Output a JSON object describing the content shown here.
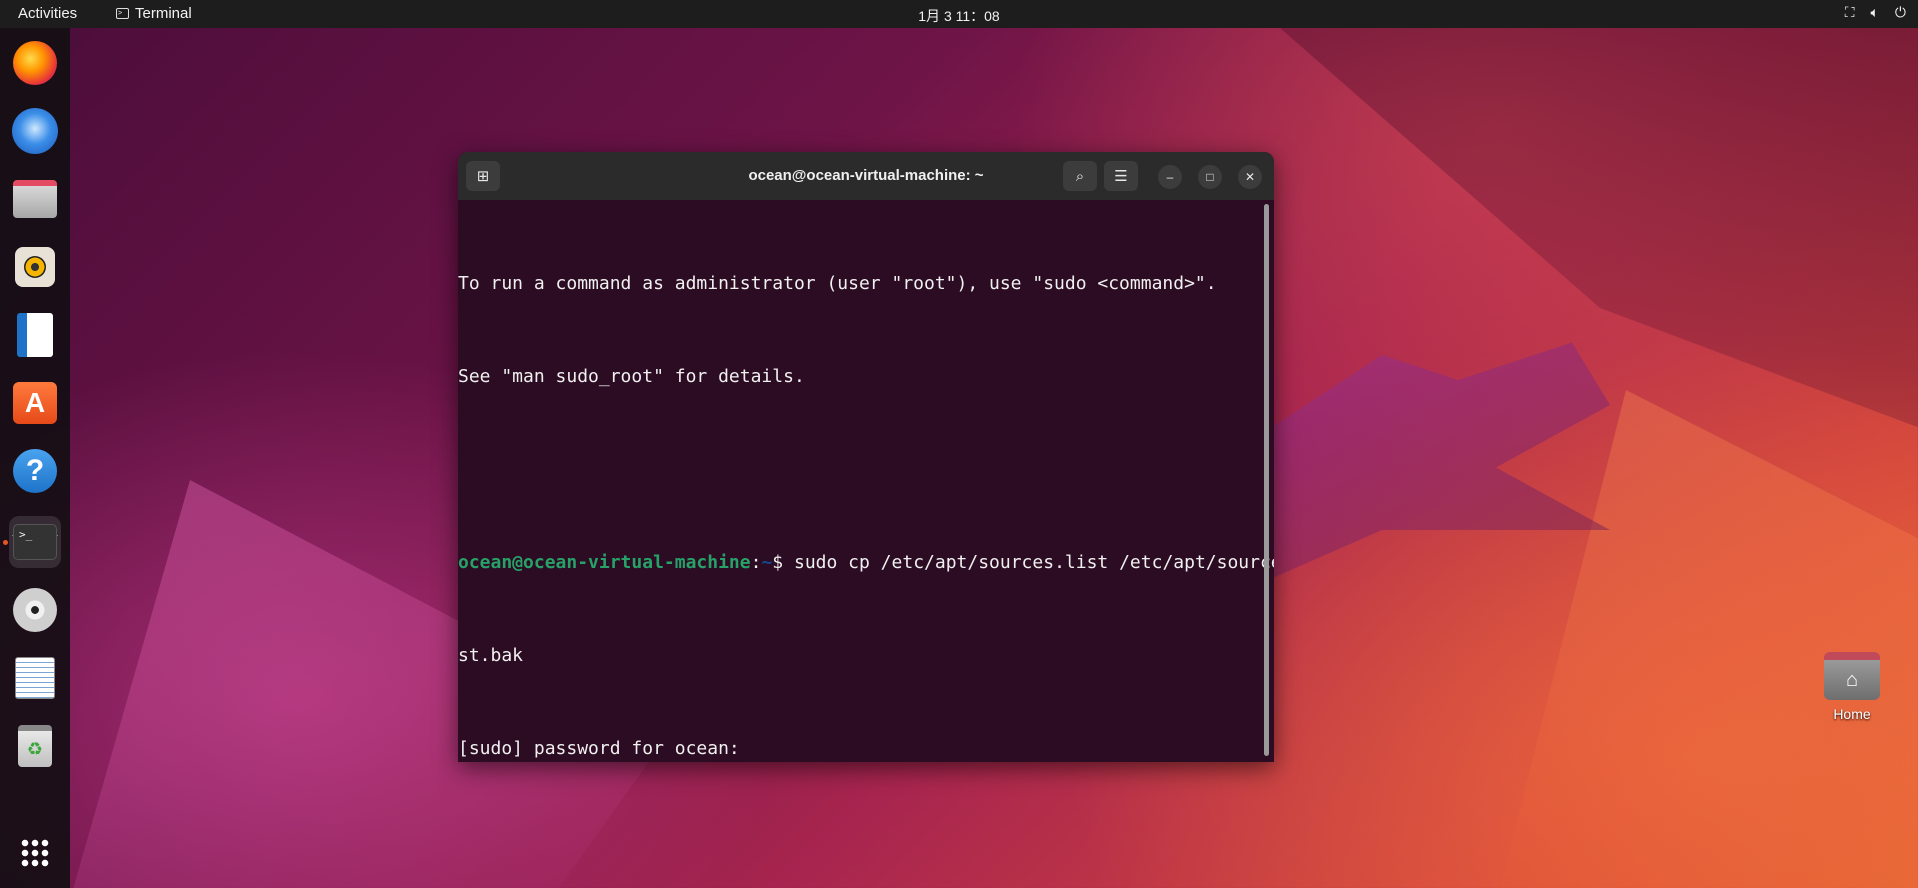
{
  "topbar": {
    "activities": "Activities",
    "app_name": "Terminal",
    "clock": "1月 3  11：08",
    "tray_icons": [
      "network-icon",
      "volume-icon",
      "power-icon"
    ]
  },
  "dock": {
    "apps": [
      {
        "name": "firefox",
        "icon": "firefox-icon"
      },
      {
        "name": "thunderbird",
        "icon": "thunderbird-icon"
      },
      {
        "name": "files",
        "icon": "files-icon"
      },
      {
        "name": "rhythmbox",
        "icon": "rhythmbox-icon"
      },
      {
        "name": "libreoffice-writer",
        "icon": "writer-icon"
      },
      {
        "name": "ubuntu-software",
        "icon": "software-store-icon"
      },
      {
        "name": "help",
        "icon": "help-icon"
      },
      {
        "name": "terminal",
        "icon": "terminal-icon",
        "running": true
      },
      {
        "name": "disc",
        "icon": "disc-icon"
      },
      {
        "name": "text-editor",
        "icon": "text-editor-icon"
      },
      {
        "name": "trash",
        "icon": "trash-icon"
      }
    ],
    "store_glyph": "A",
    "help_glyph": "?",
    "terminal_glyph": ">_"
  },
  "desktop": {
    "home_label": "Home"
  },
  "window": {
    "title": "ocean@ocean-virtual-machine: ~",
    "accent": "#26a269",
    "background": "#2c0c22"
  },
  "terminal": {
    "line1": "To run a command as administrator (user \"root\"), use \"sudo <command>\".",
    "line2": "See \"man sudo_root\" for details.",
    "prompt_user": "ocean@ocean-virtual-machine",
    "prompt_colon": ":",
    "prompt_path": "~",
    "prompt_symbol": "$ ",
    "command1_a": "sudo cp /etc/apt/sources.list /etc/apt/sources.li",
    "command1_b": "st.bak",
    "sudo_prompt": "[sudo] password for ocean:"
  }
}
